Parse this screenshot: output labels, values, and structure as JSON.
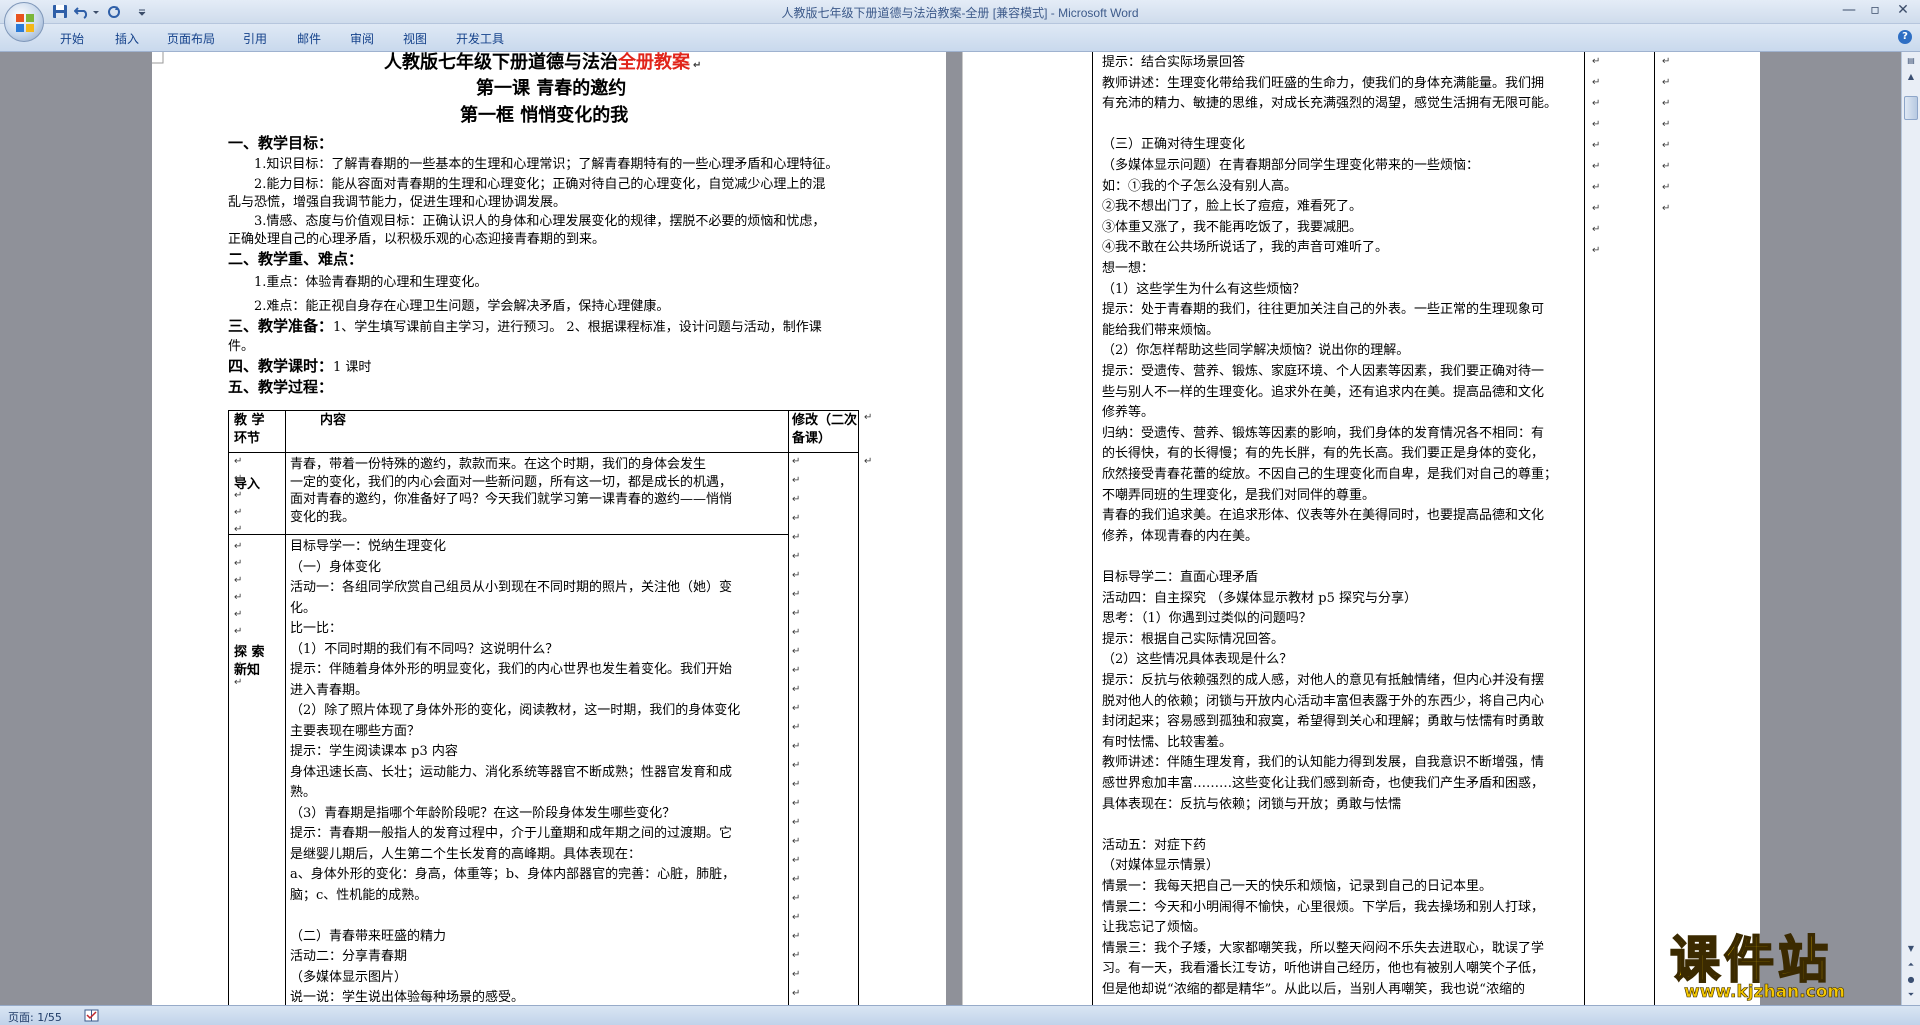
{
  "window": {
    "title": "人教版七年级下册道德与法治教案-全册 [兼容模式] - Microsoft Word",
    "minimize": "—",
    "restore": "▫",
    "close": "✕"
  },
  "ribbon": {
    "tabs": [
      "开始",
      "插入",
      "页面布局",
      "引用",
      "邮件",
      "审阅",
      "视图",
      "开发工具"
    ],
    "help": "?"
  },
  "colors": {
    "accent": "#15428b",
    "heading_red": "#e1251b",
    "watermark": "#f5c800"
  },
  "left_page": {
    "title_prefix": "人教版七年级下册道德与法治",
    "title_red": "全册教案",
    "lesson": "第一课  青春的邀约",
    "section": "第一框    悄悄变化的我",
    "goals_heading": "一、教学目标：",
    "goal1": "1.知识目标：了解青春期的一些基本的生理和心理常识；了解青春期特有的一些心理矛盾和心理特征。",
    "goal2a": "2.能力目标：能从容面对青春期的生理和心理变化；正确对待自己的心理变化，自觉减少心理上的混",
    "goal2b": "乱与恐慌，增强自我调节能力，促进生理和心理协调发展。",
    "goal3a": "3.情感、态度与价值观目标：正确认识人的身体和心理发展变化的规律，摆脱不必要的烦恼和忧虑，",
    "goal3b": "正确处理自己的心理矛盾，以积极乐观的心态迎接青春期的到来。",
    "key_heading": "二、教学重、难点：",
    "key1": "1.重点：体验青春期的心理和生理变化。",
    "key2": "2.难点：能正视自身存在心理卫生问题，学会解决矛盾，保持心理健康。",
    "prep_label": "三、教学准备：",
    "prep_text_a": "1、学生填写课前自主学习，进行预习。  2、根据课程标准，设计问题与活动，制作课",
    "prep_text_b": "件。",
    "hours_label": "四、教学课时：",
    "hours_text": "1 课时",
    "process_heading": "五、教学过程：",
    "table": {
      "head_link": "教    学",
      "head_link2": "环节",
      "head_content": "内容",
      "head_rev": "修改（二次",
      "head_rev2": "备课）",
      "intro_label": "导入",
      "intro_lines": [
        "        青春，带着一份特殊的邀约，款款而来。在这个时期，我们的身体会发生",
        "一定的变化，我们的内心会面对一些新问题，所有这一切，都是成长的机遇，",
        "面对青春的邀约，你准备好了吗？今天我们就学习第一课青春的邀约——悄悄",
        "变化的我。"
      ],
      "explore_label1": "探    索",
      "explore_label2": "新知",
      "explore_lines": [
        "目标导学一：悦纳生理变化",
        "（一）身体变化",
        "活动一：各组同学欣赏自己组员从小到现在不同时期的照片，关注他（她）变",
        "化。",
        "比一比：",
        "（1）不同时期的我们有不同吗？这说明什么？",
        "提示：伴随着身体外形的明显变化，我们的内心世界也发生着变化。我们开始",
        "进入青春期。",
        "（2）除了照片体现了身体外形的变化，阅读教材，这一时期，我们的身体变化",
        "主要表现在哪些方面？",
        "提示：学生阅读课本 p3 内容",
        "身体迅速长高、长壮；运动能力、消化系统等器官不断成熟；性器官发育和成",
        "熟。",
        "（3）青春期是指哪个年龄阶段呢？在这一阶段身体发生哪些变化？",
        "提示：青春期一般指人的发育过程中，介于儿童期和成年期之间的过渡期。它",
        "是继婴儿期后，人生第二个生长发育的高峰期。具体表现在：",
        "a、身体外形的变化：身高，体重等；b、身体内部器官的完善：心脏，肺脏，",
        "脑；c、性机能的成熟。",
        "",
        "（二）青春带来旺盛的精力",
        "活动二：分享青春期",
        "（多媒体显示图片）",
        "说一说：学生说出体验每种场景的感受。"
      ]
    }
  },
  "right_page": {
    "lines": [
      "提示：结合实际场景回答",
      "教师讲述：生理变化带给我们旺盛的生命力，使我们的身体充满能量。我们拥",
      "有充沛的精力、敏捷的思维，对成长充满强烈的渴望，感觉生活拥有无限可能。",
      "",
      "（三）正确对待生理变化",
      "（多媒体显示问题）在青春期部分同学生理变化带来的一些烦恼：",
      "如：①我的个子怎么没有别人高。",
      "②我不想出门了，脸上长了痘痘，难看死了。",
      "③体重又涨了，我不能再吃饭了，我要减肥。",
      "④我不敢在公共场所说话了，我的声音可难听了。",
      "想一想：",
      "（1）这些学生为什么有这些烦恼？",
      "提示：处于青春期的我们，往往更加关注自己的外表。一些正常的生理现象可",
      "能给我们带来烦恼。",
      "（2）你怎样帮助这些同学解决烦恼？说出你的理解。",
      "提示：受遗传、营养、锻炼、家庭环境、个人因素等因素，我们要正确对待一",
      "些与别人不一样的生理变化。追求外在美，还有追求内在美。提高品德和文化",
      "修养等。",
      "归纳：受遗传、营养、锻炼等因素的影响，我们身体的发育情况各不相同：有",
      "的长得快，有的长得慢；有的先长胖，有的先长高。我们要正是身体的变化，",
      "欣然接受青春花蕾的绽放。不因自己的生理变化而自卑，是我们对自己的尊重；",
      "不嘲弄同班的生理变化，是我们对同伴的尊重。",
      "青春的我们追求美。在追求形体、仪表等外在美得同时，也要提高品德和文化",
      "修养，体现青春的内在美。",
      "",
      "目标导学二：直面心理矛盾",
      "活动四：自主探究 （多媒体显示教材 p5 探究与分享）",
      "思考：（1）你遇到过类似的问题吗？",
      "提示：根据自己实际情况回答。",
      "（2）这些情况具体表现是什么？",
      "提示：反抗与依赖强烈的成人感，对他人的意见有抵触情绪，但内心并没有摆",
      "脱对他人的依赖；闭锁与开放内心活动丰富但表露于外的东西少，将自己内心",
      "封闭起来；容易感到孤独和寂寞，希望得到关心和理解；勇敢与怯懦有时勇敢",
      "有时怯懦、比较害羞。",
      "教师讲述：伴随生理发育，我们的认知能力得到发展，自我意识不断增强，情",
      "感世界愈加丰富………这些变化让我们感到新奇，也使我们产生矛盾和困惑，",
      "具体表现在：反抗与依赖；闭锁与开放；勇敢与怯懦",
      "",
      "活动五：对症下药",
      "（对媒体显示情景）",
      "情景一：我每天把自己一天的快乐和烦恼，记录到自己的日记本里。",
      "情景二：今天和小明闹得不愉快，心里很烦。下学后，我去操场和别人打球，",
      "让我忘记了烦恼。",
      "情景三：我个子矮，大家都嘲笑我，所以整天闷闷不乐失去进取心，耽误了学",
      "习。有一天，我看潘长江专访，听他讲自己经历，他也有被别人嘲笑个子低，",
      "但是他却说“浓缩的都是精华”。从此以后，当别人再嘲笑，我也说“浓缩的"
    ]
  },
  "status": {
    "page": "页面: 1/55"
  },
  "watermark": {
    "logo": "课件站",
    "url": "www.kjzhan.com"
  }
}
